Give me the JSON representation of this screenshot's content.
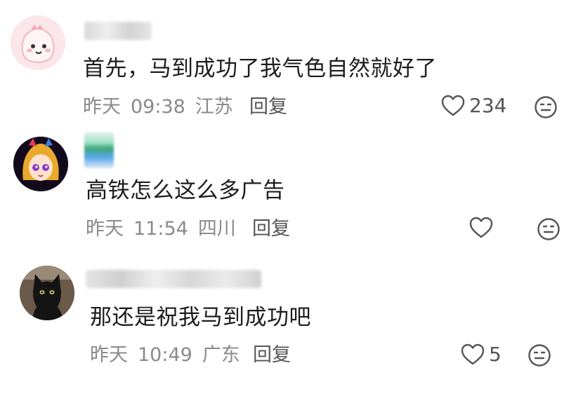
{
  "comments": [
    {
      "username": "",
      "text": "首先，马到成功了我气色自然就好了",
      "date": "昨天",
      "time": "09:38",
      "location": "江苏",
      "reply_label": "回复",
      "likes": "234",
      "avatar_icon": "cartoon-pink-avatar"
    },
    {
      "username": "",
      "text": "高铁怎么这么多广告",
      "date": "昨天",
      "time": "11:54",
      "location": "四川",
      "reply_label": "回复",
      "likes": "",
      "avatar_icon": "anime-girl-avatar"
    },
    {
      "username": "",
      "text": "那还是祝我马到成功吧",
      "date": "昨天",
      "time": "10:49",
      "location": "广东",
      "reply_label": "回复",
      "likes": "5",
      "avatar_icon": "black-cat-avatar"
    }
  ],
  "colors": {
    "meta_gray": "#8a8a8a",
    "text": "#1c1c1c",
    "icon": "#555555"
  }
}
